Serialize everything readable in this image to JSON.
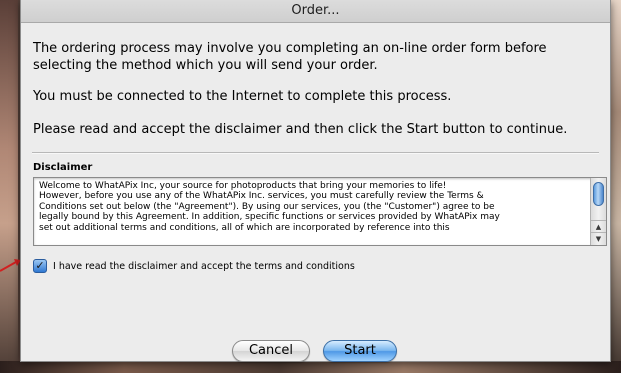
{
  "dialog": {
    "title": "Order..."
  },
  "body": {
    "paragraph1": "The ordering process may involve you completing an on-line order form before selecting the method which you will send your order.",
    "paragraph2": "You must be connected to the Internet to complete this process.",
    "paragraph3": "Please read and accept the disclaimer and then click the Start button to continue."
  },
  "disclaimer": {
    "label": "Disclaimer",
    "text": "Welcome to WhatAPix Inc, your source for photoproducts that bring your memories to life!\nHowever, before you use any of the WhatAPix Inc. services, you must carefully review the Terms &\nConditions set out below (the \"Agreement\"). By using our services, you (the \"Customer\") agree to be\nlegally bound by this Agreement.  In addition, specific functions or services provided by WhatAPix may\nset out additional terms and conditions, all of which are incorporated by reference into this"
  },
  "accept": {
    "label": "I have read the disclaimer and accept the terms and conditions",
    "checked": true
  },
  "buttons": {
    "cancel": "Cancel",
    "start": "Start"
  },
  "colors": {
    "accent": "#4e98e6",
    "annotation_arrow": "#d22020"
  }
}
